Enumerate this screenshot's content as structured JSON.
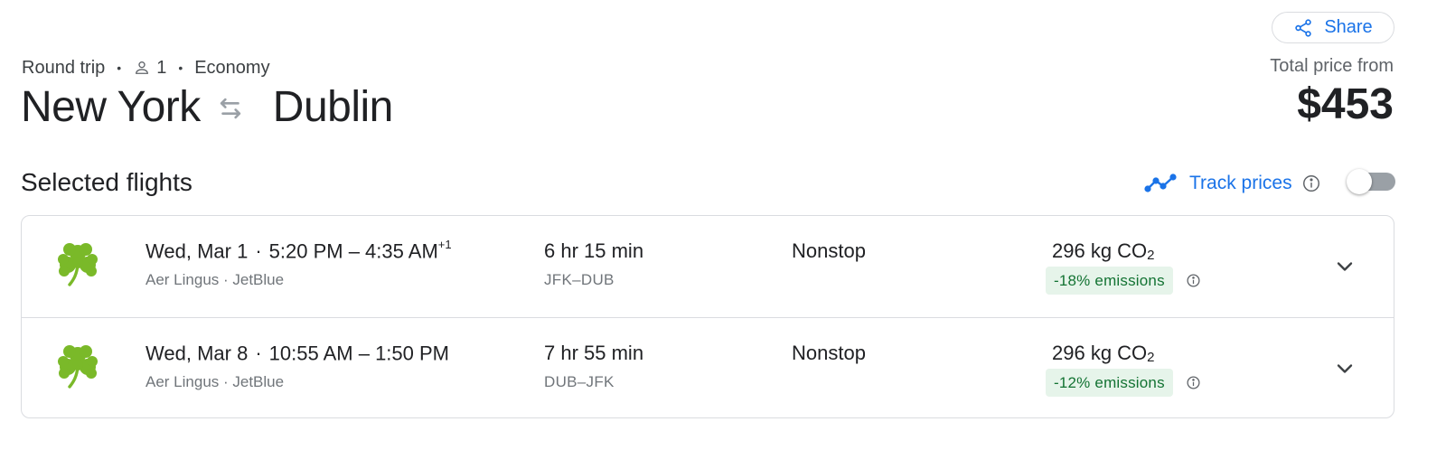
{
  "header": {
    "share_label": "Share",
    "trip_type": "Round trip",
    "passengers": "1",
    "cabin": "Economy",
    "origin": "New York",
    "destination": "Dublin",
    "total_price_label": "Total price from",
    "total_price": "$453"
  },
  "section": {
    "title": "Selected flights",
    "track_prices_label": "Track prices",
    "track_prices_enabled": false
  },
  "icons": {
    "share": "share-icon",
    "passenger": "person-icon",
    "swap": "swap-arrows-icon",
    "trend": "trend-line-icon",
    "info": "info-icon",
    "airline_logo": "shamrock-logo",
    "expand": "chevron-down-icon"
  },
  "colors": {
    "accent": "#1a73e8",
    "emissions_badge_bg": "#e6f4ea",
    "emissions_badge_text": "#137333",
    "logo_green": "#7ab929"
  },
  "flights": [
    {
      "date": "Wed, Mar 1",
      "depart": "5:20 PM",
      "arrive": "4:35 AM",
      "day_offset": "+1",
      "carriers": "Aer Lingus · JetBlue",
      "duration": "6 hr 15 min",
      "route": "JFK–DUB",
      "stops": "Nonstop",
      "co2_value": "296 kg CO",
      "co2_sub": "2",
      "emissions": "-18% emissions"
    },
    {
      "date": "Wed, Mar 8",
      "depart": "10:55 AM",
      "arrive": "1:50 PM",
      "day_offset": "",
      "carriers": "Aer Lingus · JetBlue",
      "duration": "7 hr 55 min",
      "route": "DUB–JFK",
      "stops": "Nonstop",
      "co2_value": "296 kg CO",
      "co2_sub": "2",
      "emissions": "-12% emissions"
    }
  ]
}
